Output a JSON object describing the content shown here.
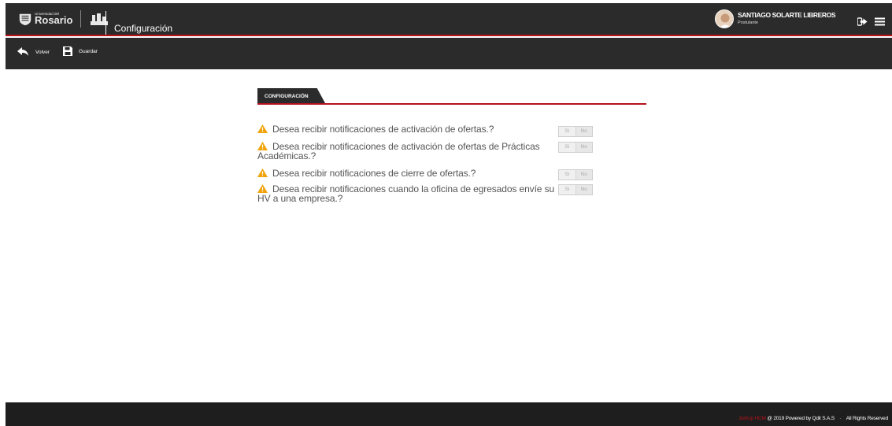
{
  "header": {
    "logo_small": "Universidad del",
    "logo_big": "Rosario",
    "page_title": "Configuración",
    "user_name": "SANTIAGO SOLARTE LIBREROS",
    "user_role": "Postulante"
  },
  "toolbar": {
    "back_label": "Volver",
    "save_label": "Guardar"
  },
  "section": {
    "tab_label": "CONFIGURACIÓN"
  },
  "options": [
    {
      "text": "Desea recibir notificaciones de activación de ofertas.?",
      "yes": "Si",
      "no": "No"
    },
    {
      "text": "Desea recibir notificaciones de activación de ofertas de Prácticas Académicas.?",
      "yes": "Si",
      "no": "No"
    },
    {
      "text": "Desea recibir notificaciones de cierre de ofertas.?",
      "yes": "Si",
      "no": "No"
    },
    {
      "text": "Desea recibir notificaciones cuando la oficina de egresados envíe su HV a una empresa.?",
      "yes": "Si",
      "no": "No"
    }
  ],
  "footer": {
    "brand": "JoinUp HCM",
    "powered": "@ 2019 Powered by Qdit S.A.S",
    "separator": "-",
    "rights": "All Rights Reserved"
  },
  "colors": {
    "bar": "#2b2b2b",
    "accent": "#b5121b",
    "warning": "#f0a30a"
  },
  "icons": [
    "university-crest-icon",
    "building-icon",
    "logout-icon",
    "menu-icon",
    "back-arrow-icon",
    "save-icon",
    "warning-icon"
  ]
}
